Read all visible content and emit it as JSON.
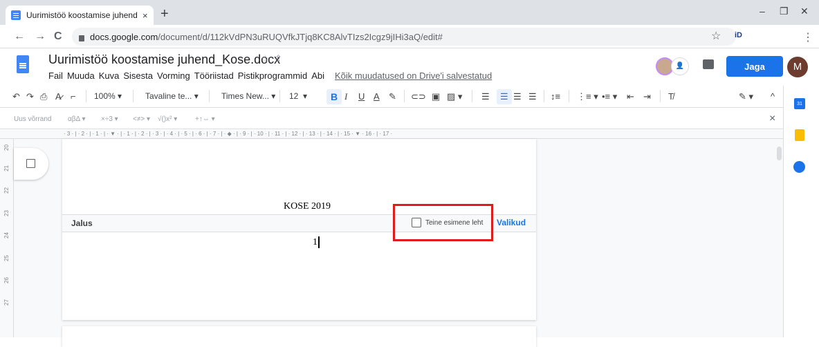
{
  "browser": {
    "tab_title": "Uurimistöö koostamise juhend_K",
    "tab_close": "×",
    "new_tab": "+",
    "win_min": "–",
    "win_max": "❐",
    "win_close": "✕",
    "back": "←",
    "forward": "→",
    "reload": "C",
    "url_domain": "docs.google.com",
    "url_path": "/document/d/112kVdPN3uRUQVfkJTjq8KC8AlvTIzs2Icgz9jIHi3aQ/edit#",
    "star": "☆",
    "ext_id": "iD",
    "profile": "M",
    "menu": "⋮"
  },
  "doc": {
    "title": "Uurimistöö koostamise juhend_Kose.docx",
    "star": "☆",
    "move": "⇪",
    "menus": [
      "Fail",
      "Muuda",
      "Kuva",
      "Sisesta",
      "Vorming",
      "Tööriistad",
      "Pistikprogrammid",
      "Abi"
    ],
    "saved_status": "Kõik muudatused on Drive'i salvestatud",
    "share_label": "Jaga",
    "user_initial": "M"
  },
  "toolbar": {
    "zoom": "100%",
    "style": "Tavaline te...",
    "font": "Times New...",
    "size": "12",
    "bold": "B",
    "italic": "I",
    "underline": "U",
    "text_color": "A"
  },
  "equation": {
    "new_equation": "Uus võrrand",
    "greek": "αβΔ",
    "ops": "×÷3",
    "relations": "<≠>",
    "math": "√()x²",
    "arrows": "+↑⇔",
    "close": "×"
  },
  "ruler_h": "· 3 · | · 2 · | · 1 · | · ▼ · | · 1 · | · 2 · | · 3 · | · 4 · | · 5 · | · 6 · | · 7 · | · ◆ · | · 9 · | · 10 · | · 11 · | · 12 · | · 13 · | · 14 · | · 15 · ▼ · 16 · | · 17 ·",
  "ruler_v": [
    "20",
    "21",
    "22",
    "23",
    "24",
    "25",
    "26",
    "27"
  ],
  "page": {
    "header_text": "KOSE 2019",
    "footer_label": "Jalus",
    "different_first_page": "Teine esimene leht",
    "options": "Valikud",
    "page_number": "1"
  },
  "side": {
    "calendar": "31"
  }
}
